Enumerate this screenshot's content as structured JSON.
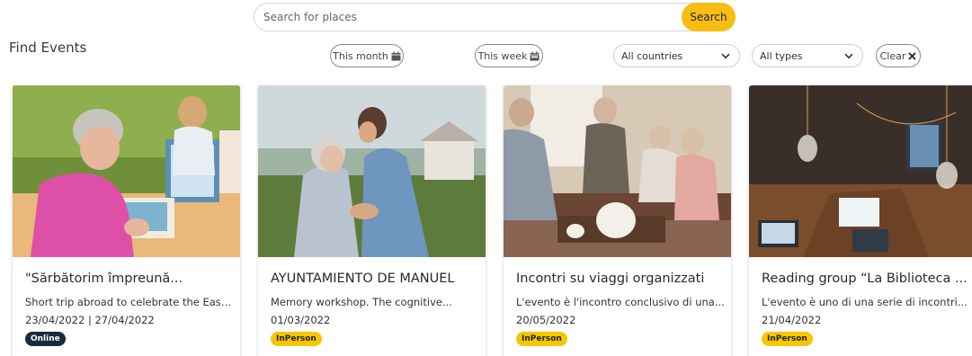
{
  "search": {
    "placeholder": "Search for places",
    "button_label": "Search"
  },
  "page_title": "Find Events",
  "filters": {
    "this_month": "This month",
    "this_week": "This week",
    "country_select": "All countries",
    "type_select": "All types",
    "clear": "Clear"
  },
  "colors": {
    "accent": "#f7bd12",
    "online_badge": "#1b2a3a",
    "inperson_badge": "#f7c600"
  },
  "events": [
    {
      "title": "\"Sărbătorim împreună...",
      "description": "Short trip abroad to celebrate the East...",
      "date": "23/04/2022 | 27/04/2022",
      "badge": "Online",
      "image": "painting-class-photo"
    },
    {
      "title": "AYUNTAMIENTO DE MANUEL",
      "description": "Memory workshop. The cognitive...",
      "date": "01/03/2022",
      "badge": "InPerson",
      "image": "garden-embrace-photo"
    },
    {
      "title": "Incontri su viaggi organizzati",
      "description": "L'evento è l'incontro conclusivo di una...",
      "date": "20/05/2022",
      "badge": "InPerson",
      "image": "living-room-tea-photo"
    },
    {
      "title": "Reading group “La Biblioteca ...",
      "description": "L'evento è uno di una serie di incontri...",
      "date": "21/04/2022",
      "badge": "InPerson",
      "image": "workspace-lightbulbs-photo"
    }
  ]
}
